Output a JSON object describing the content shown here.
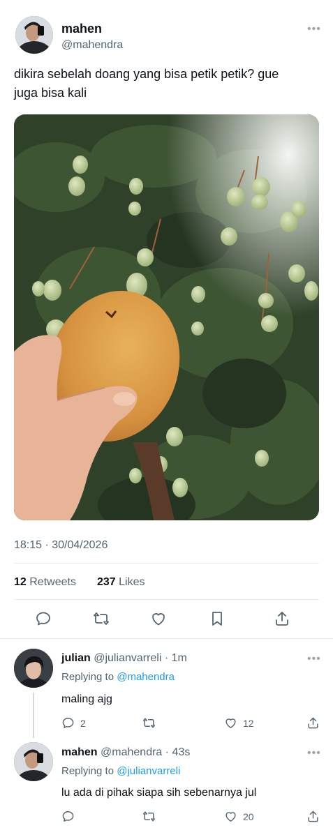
{
  "main_tweet": {
    "name": "mahen",
    "handle": "@mahendra",
    "text_line1": "dikira sebelah doang yang bisa petik petik? gue",
    "text_line2": "juga bisa kali",
    "timestamp": "18:15 · 30/04/2026",
    "retweets_count": "12",
    "retweets_label": "Retweets",
    "likes_count": "237",
    "likes_label": "Likes"
  },
  "replies": [
    {
      "name": "julian",
      "meta": "@julianvarreli · 1m",
      "replying_prefix": "Replying to",
      "replying_to": "@mahendra",
      "text": "maling ajg",
      "reply_count": "2",
      "like_count": "12"
    },
    {
      "name": "mahen",
      "meta": "@mahendra · 43s",
      "replying_prefix": "Replying to",
      "replying_to": "@julianvarreli",
      "text": "lu ada di pihak siapa sih sebenarnya jul",
      "reply_count": "",
      "like_count": "20"
    }
  ],
  "more_glyph": "•••",
  "icons": [
    "reply-icon",
    "retweet-icon",
    "like-icon",
    "bookmark-icon",
    "share-icon"
  ],
  "colors": {
    "text": "#0f1419",
    "secondary": "#536471",
    "link": "#1d9bf0",
    "divider": "#e6ecf0"
  }
}
